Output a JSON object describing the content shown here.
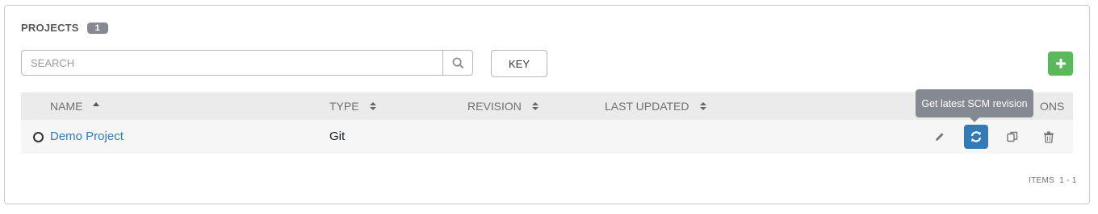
{
  "header": {
    "title": "PROJECTS",
    "count": "1"
  },
  "search": {
    "placeholder": "SEARCH",
    "value": ""
  },
  "toolbar": {
    "key_label": "KEY",
    "add_label": "+"
  },
  "table": {
    "columns": [
      {
        "label": "NAME",
        "sort": "asc"
      },
      {
        "label": "TYPE",
        "sort": "both"
      },
      {
        "label": "REVISION",
        "sort": "both"
      },
      {
        "label": "LAST UPDATED",
        "sort": "both"
      },
      {
        "label": "ONS"
      }
    ],
    "rows": [
      {
        "name": "Demo Project",
        "type": "Git",
        "revision": "",
        "last_updated": ""
      }
    ]
  },
  "tooltip": {
    "text": "Get latest SCM revision"
  },
  "footer": {
    "items_label": "ITEMS",
    "range": "1 - 1"
  },
  "colors": {
    "accent": "#337ab7",
    "add": "#5cb85c",
    "badge": "#848992"
  },
  "icons": [
    "search-icon",
    "plus-icon",
    "sort-up-icon",
    "sort-icon",
    "edit-icon",
    "refresh-icon",
    "copy-icon",
    "trash-icon",
    "status-circle-icon"
  ]
}
